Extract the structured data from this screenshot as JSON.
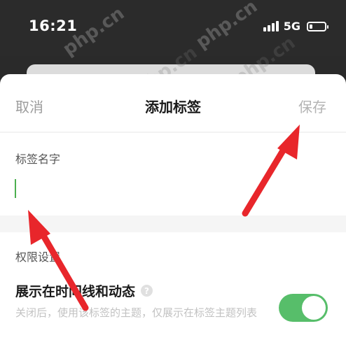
{
  "status_bar": {
    "time": "16:21",
    "network": "5G",
    "battery_fraction": 0.18
  },
  "watermark": "php.cn",
  "nav": {
    "cancel_label": "取消",
    "title": "添加标签",
    "save_label": "保存"
  },
  "tag_name": {
    "label": "标签名字",
    "value": ""
  },
  "permissions": {
    "label": "权限设置",
    "show_in_timeline": {
      "title": "展示在时间线和动态",
      "help_icon": "question-circle-icon",
      "description": "关闭后，使用该标签的主题，仅展示在标签主题列表",
      "enabled": true
    }
  },
  "colors": {
    "accent": "#57be6a",
    "arrow": "#e8262b",
    "status_bg": "#2b2b2b"
  }
}
